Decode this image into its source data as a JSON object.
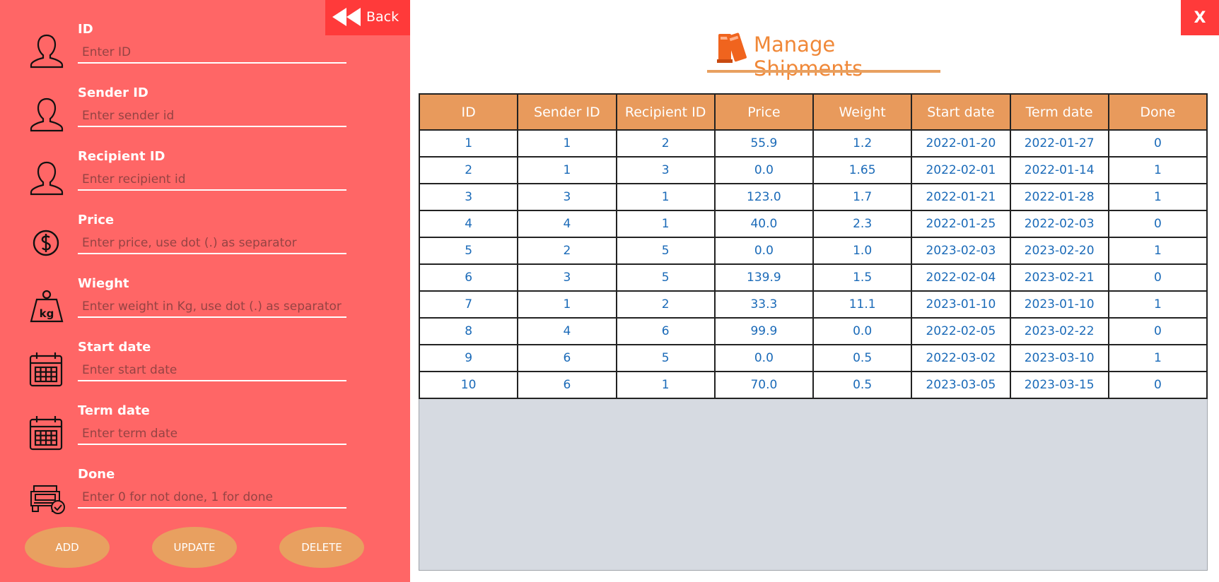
{
  "back_button": {
    "label": "Back"
  },
  "close_button": {
    "label": "X"
  },
  "title": "Manage Shipments",
  "form": {
    "fields": [
      {
        "label": "ID",
        "placeholder": "Enter ID",
        "icon": "user-icon"
      },
      {
        "label": "Sender ID",
        "placeholder": "Enter sender id",
        "icon": "user-icon"
      },
      {
        "label": "Recipient ID",
        "placeholder": "Enter recipient id",
        "icon": "user-icon"
      },
      {
        "label": "Price",
        "placeholder": "Enter price, use dot (.) as separator",
        "icon": "dollar-icon"
      },
      {
        "label": "Wieght",
        "placeholder": "Enter weight in Kg, use dot (.) as separator",
        "icon": "weight-icon"
      },
      {
        "label": "Start date",
        "placeholder": "Enter start date",
        "icon": "calendar-icon"
      },
      {
        "label": "Term date",
        "placeholder": "Enter term date",
        "icon": "calendar-icon"
      },
      {
        "label": "Done",
        "placeholder": "Enter 0 for not done, 1 for done",
        "icon": "truck-check-icon"
      }
    ],
    "buttons": {
      "add": "ADD",
      "update": "UPDATE",
      "delete": "DELETE"
    }
  },
  "table": {
    "columns": [
      "ID",
      "Sender ID",
      "Recipient ID",
      "Price",
      "Weight",
      "Start date",
      "Term date",
      "Done"
    ],
    "rows": [
      [
        "1",
        "1",
        "2",
        "55.9",
        "1.2",
        "2022-01-20",
        "2022-01-27",
        "0"
      ],
      [
        "2",
        "1",
        "3",
        "0.0",
        "1.65",
        "2022-02-01",
        "2022-01-14",
        "1"
      ],
      [
        "3",
        "3",
        "1",
        "123.0",
        "1.7",
        "2022-01-21",
        "2022-01-28",
        "1"
      ],
      [
        "4",
        "4",
        "1",
        "40.0",
        "2.3",
        "2022-01-25",
        "2022-02-03",
        "0"
      ],
      [
        "5",
        "2",
        "5",
        "0.0",
        "1.0",
        "2023-02-03",
        "2023-02-20",
        "1"
      ],
      [
        "6",
        "3",
        "5",
        "139.9",
        "1.5",
        "2022-02-04",
        "2023-02-21",
        "0"
      ],
      [
        "7",
        "1",
        "2",
        "33.3",
        "11.1",
        "2023-01-10",
        "2023-01-10",
        "1"
      ],
      [
        "8",
        "4",
        "6",
        "99.9",
        "0.0",
        "2022-02-05",
        "2023-02-22",
        "0"
      ],
      [
        "9",
        "6",
        "5",
        "0.0",
        "0.5",
        "2022-03-02",
        "2023-03-10",
        "1"
      ],
      [
        "10",
        "6",
        "1",
        "70.0",
        "0.5",
        "2023-03-05",
        "2023-03-15",
        "0"
      ]
    ]
  },
  "colors": {
    "panel": "#ff6666",
    "accent_red": "#ff3a3a",
    "header_orange": "#e89a5c",
    "title_orange": "#f08838",
    "cell_text": "#1a6ab8",
    "empty_area": "#d6dae1"
  }
}
